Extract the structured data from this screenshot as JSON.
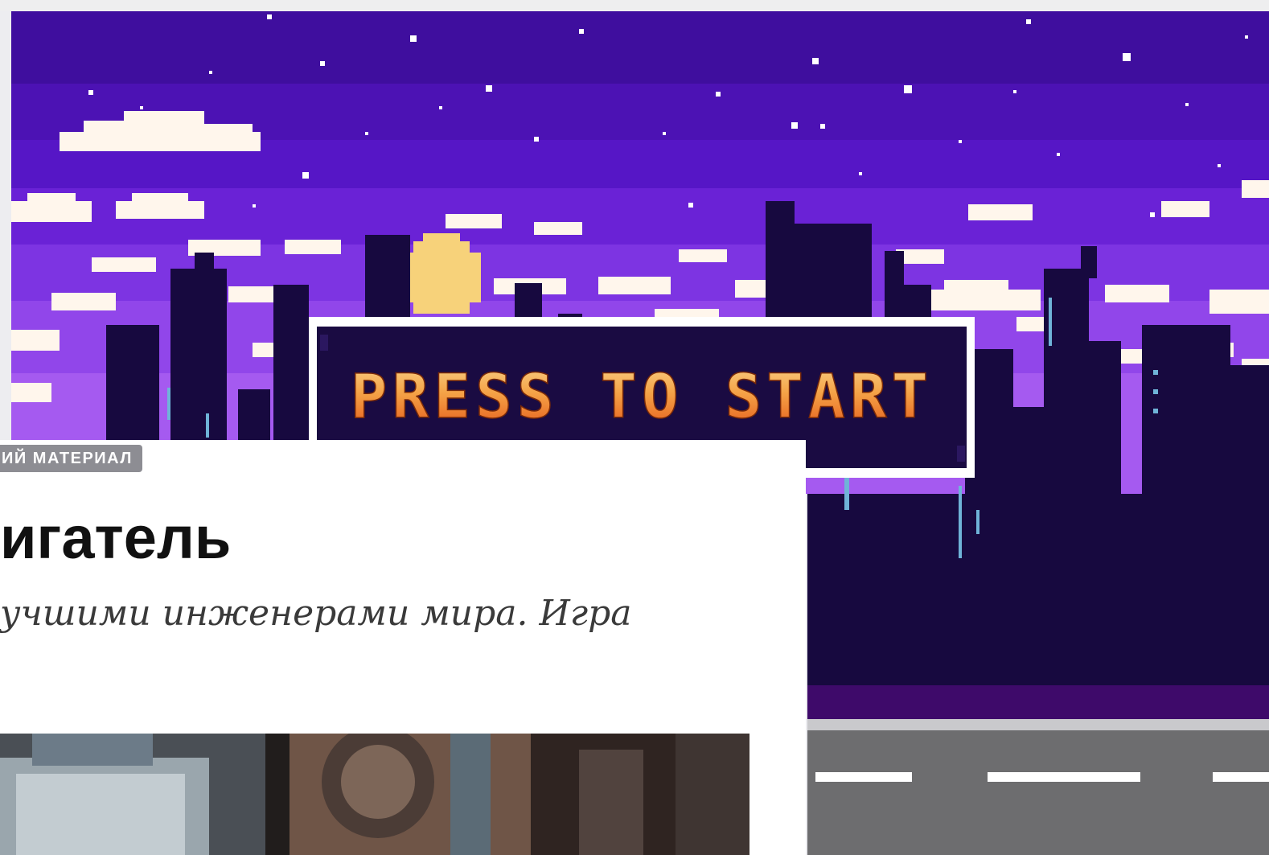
{
  "hero": {
    "banner_text": "PRESS TO START",
    "colors": {
      "sky_top": "#3f0e9e",
      "sky_mid": "#6a1fd6",
      "sky_low": "#9a4ff0",
      "skyline": "#17093f",
      "banner_border": "#ffffff",
      "text_top": "#f7c36a",
      "text_bottom": "#e8621e",
      "road": "#6d6d6f"
    }
  },
  "card": {
    "badge": "ИЙ МАТЕРИАЛ",
    "headline": "игатель",
    "lead": "учшими инженерами мира. Игра"
  }
}
